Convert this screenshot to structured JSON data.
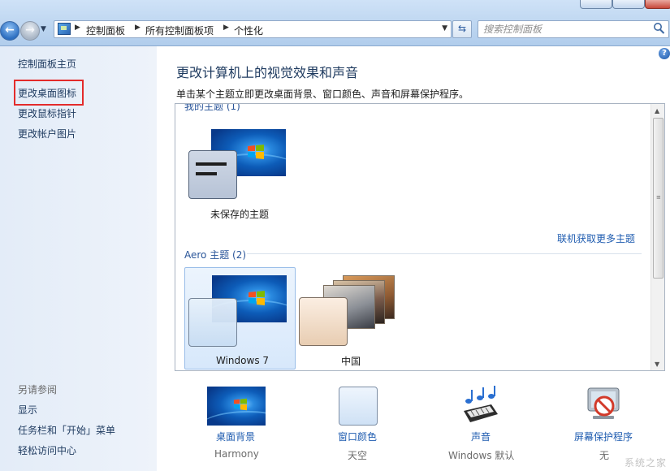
{
  "address_bar": {
    "breadcrumbs": [
      "控制面板",
      "所有控制面板项",
      "个性化"
    ],
    "search_placeholder": "搜索控制面板"
  },
  "left_pane": {
    "links": [
      "控制面板主页",
      "更改桌面图标",
      "更改鼠标指针",
      "更改帐户图片"
    ],
    "highlighted_link": "更改桌面图标",
    "see_also_heading": "另请参阅",
    "see_also_links": [
      "显示",
      "任务栏和「开始」菜单",
      "轻松访问中心"
    ]
  },
  "main": {
    "title": "更改计算机上的视觉效果和声音",
    "subtitle": "单击某个主题立即更改桌面背景、窗口颜色、声音和屏幕保护程序。",
    "my_themes_header": "我的主题 (1)",
    "unsaved_theme_label": "未保存的主题",
    "get_more_themes_link": "联机获取更多主题",
    "aero_header": "Aero 主题 (2)",
    "aero_themes": [
      {
        "label": "Windows 7",
        "selected": true
      },
      {
        "label": "中国",
        "selected": false
      }
    ]
  },
  "bottom_bar": [
    {
      "label": "桌面背景",
      "value": "Harmony",
      "icon": "desktop-background-icon"
    },
    {
      "label": "窗口颜色",
      "value": "天空",
      "icon": "window-color-icon"
    },
    {
      "label": "声音",
      "value": "Windows 默认",
      "icon": "sound-notes-icon"
    },
    {
      "label": "屏幕保护程序",
      "value": "无",
      "icon": "screensaver-icon"
    }
  ],
  "watermark": "系统之家",
  "colors": {
    "highlight_box": "#e32b2b",
    "link_blue": "#1f5cb0",
    "left_pane_bg": "#e3ecf8"
  }
}
